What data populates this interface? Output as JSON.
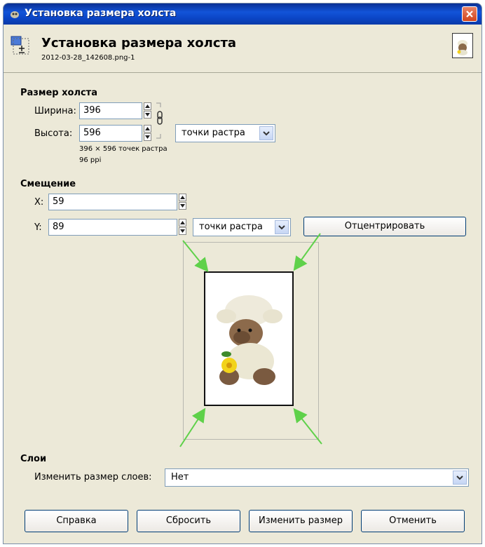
{
  "window": {
    "title": "Установка размера холста"
  },
  "header": {
    "title": "Установка размера холста",
    "subtitle": "2012-03-28_142608.png-1"
  },
  "canvas_size": {
    "section_label": "Размер холста",
    "width_label": "Ширина:",
    "width_value": "396",
    "height_label": "Высота:",
    "height_value": "596",
    "unit": "точки растра",
    "info_pixels": "396 × 596 точек растра",
    "info_ppi": "96 ppi"
  },
  "offset": {
    "section_label": "Смещение",
    "x_label": "X:",
    "x_value": "59",
    "y_label": "Y:",
    "y_value": "89",
    "unit": "точки растра",
    "center_button": "Отцентрировать"
  },
  "layers": {
    "section_label": "Слои",
    "resize_label": "Изменить размер слоев:",
    "resize_value": "Нет"
  },
  "buttons": {
    "help": "Справка",
    "reset": "Сбросить",
    "resize": "Изменить размер",
    "cancel": "Отменить"
  },
  "colors": {
    "arrow": "#5fd14a",
    "titlebar": "#0b45c6"
  }
}
